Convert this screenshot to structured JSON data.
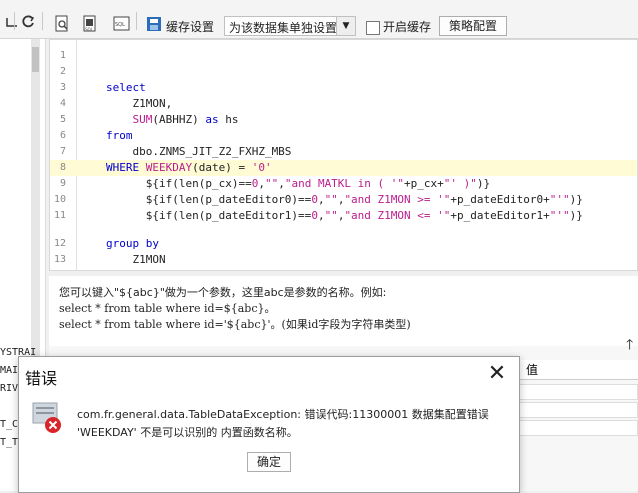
{
  "toolbar": {
    "cache_settings_label": "缓存设置",
    "dataset_select_value": "为该数据集单独设置",
    "enable_cache_label": "开启缓存",
    "strategy_button_label": "策略配置"
  },
  "left_panel": {
    "items": [
      "YSTRAI",
      "MAI",
      "RIVI",
      "T_C",
      "T_T"
    ]
  },
  "editor": {
    "lines": [
      {
        "n": "1",
        "tokens": []
      },
      {
        "n": "2",
        "tokens": []
      },
      {
        "n": "3",
        "tokens": [
          {
            "t": "select",
            "c": "kw"
          }
        ]
      },
      {
        "n": "4",
        "tokens": [
          {
            "t": "    Z1MON,",
            "c": ""
          }
        ]
      },
      {
        "n": "5",
        "tokens": [
          {
            "t": "    ",
            "c": ""
          },
          {
            "t": "SUM",
            "c": "fn"
          },
          {
            "t": "(ABHHZ) ",
            "c": ""
          },
          {
            "t": "as",
            "c": "kw"
          },
          {
            "t": " hs",
            "c": ""
          }
        ]
      },
      {
        "n": "6",
        "tokens": [
          {
            "t": "from",
            "c": "kw"
          }
        ]
      },
      {
        "n": "7",
        "tokens": [
          {
            "t": "    dbo.ZNMS_JIT_Z2_FXHZ_MBS",
            "c": ""
          }
        ]
      },
      {
        "n": "8",
        "tokens": [
          {
            "t": "WHERE ",
            "c": "kw"
          },
          {
            "t": "WEEKDAY",
            "c": "fn"
          },
          {
            "t": "(date) = ",
            "c": ""
          },
          {
            "t": "'0'",
            "c": "str"
          }
        ]
      },
      {
        "n": "9",
        "tokens": [
          {
            "t": "      ${if(len(p_cx)==",
            "c": ""
          },
          {
            "t": "0",
            "c": "num"
          },
          {
            "t": ",",
            "c": ""
          },
          {
            "t": "\"\"",
            "c": "str"
          },
          {
            "t": ",",
            "c": ""
          },
          {
            "t": "\"and MATKL in ( '\"",
            "c": "str"
          },
          {
            "t": "+p_cx+",
            "c": ""
          },
          {
            "t": "\"' )\"",
            "c": "str"
          },
          {
            "t": ")}",
            "c": ""
          }
        ]
      },
      {
        "n": "10",
        "tokens": [
          {
            "t": "      ${if(len(p_dateEditor0)==",
            "c": ""
          },
          {
            "t": "0",
            "c": "num"
          },
          {
            "t": ",",
            "c": ""
          },
          {
            "t": "\"\"",
            "c": "str"
          },
          {
            "t": ",",
            "c": ""
          },
          {
            "t": "\"and Z1MON >= '\"",
            "c": "str"
          },
          {
            "t": "+p_dateEditor0+",
            "c": ""
          },
          {
            "t": "\"'\"",
            "c": "str"
          },
          {
            "t": ")}",
            "c": ""
          }
        ]
      },
      {
        "n": "11",
        "tokens": [
          {
            "t": "      ${if(len(p_dateEditor1)==",
            "c": ""
          },
          {
            "t": "0",
            "c": "num"
          },
          {
            "t": ",",
            "c": ""
          },
          {
            "t": "\"\"",
            "c": "str"
          },
          {
            "t": ",",
            "c": ""
          },
          {
            "t": "\"and Z1MON <= '\"",
            "c": "str"
          },
          {
            "t": "+p_dateEditor1+",
            "c": ""
          },
          {
            "t": "\"'\"",
            "c": "str"
          },
          {
            "t": ")}",
            "c": ""
          }
        ]
      },
      {
        "n": "12",
        "tokens": [
          {
            "t": "group by",
            "c": "kw"
          }
        ]
      },
      {
        "n": "13",
        "tokens": [
          {
            "t": "    Z1MON",
            "c": ""
          }
        ]
      }
    ],
    "highlight_line": "8"
  },
  "hint": {
    "line1": "您可以键入\"${abc}\"做为一个参数，这里abc是参数的名称。例如:",
    "line2": "select * from table where id=${abc}。",
    "line3": "select * from table where id='${abc}'。(如果id字段为字符串类型)"
  },
  "params_panel": {
    "value_header": "值"
  },
  "dialog": {
    "title": "错误",
    "message_line1": "com.fr.general.data.TableDataException: 错误代码:11300001 数据集配置错误",
    "message_line2": "'WEEKDAY' 不是可以识别的 内置函数名称。",
    "ok_label": "确定"
  },
  "colors": {
    "keyword": "#0000cc",
    "function": "#bb1e8c",
    "highlight": "#fffbd4"
  }
}
